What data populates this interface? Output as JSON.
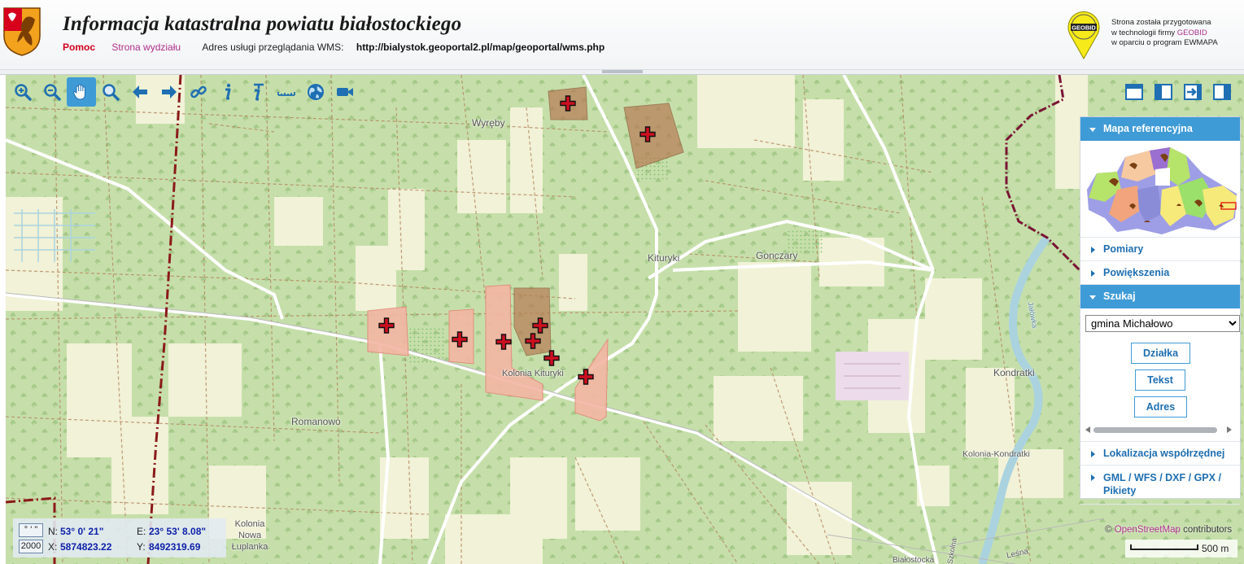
{
  "header": {
    "title": "Informacja katastralna powiatu białostockiego",
    "links": {
      "help": "Pomoc",
      "department": "Strona wydziału"
    },
    "wms_label": "Adres usługi przeglądania WMS:",
    "wms_url": "http://bialystok.geoportal2.pl/map/geoportal/wms.php",
    "vendor": {
      "logo_text": "GEOBID",
      "line1": "Strona została przygotowana",
      "line2_prefix": "w technologii firmy ",
      "line2_brand": "GEOBID",
      "line3": "w oparciu o program EWMAPA"
    }
  },
  "toolbar": {
    "tools": [
      "zoom-in-icon",
      "zoom-out-icon",
      "pan-hand-icon",
      "zoom-window-icon",
      "back-arrow-icon",
      "forward-arrow-icon",
      "link-icon",
      "info-icon",
      "info-extended-icon",
      "measure-ruler-icon",
      "globe-icon",
      "video-camera-icon"
    ],
    "active_tool": "pan-hand-icon",
    "panel_tools": [
      "layout-top-icon",
      "layout-side-icon",
      "collapse-panel-icon",
      "panel-right-icon"
    ]
  },
  "map": {
    "place_labels": [
      "Wyręby",
      "Kituryki",
      "Gonczary",
      "Kolonia Kituryki",
      "Romanowo",
      "Kondratki",
      "Kolonia-Kondratki",
      "Kolonia Nowa Łuplanka",
      "Białostocka",
      "Leśna",
      "Szkolna",
      "Jałówka"
    ],
    "attribution": {
      "prefix": "©",
      "link": "OpenStreetMap",
      "suffix": "contributors"
    },
    "scale": "500 m",
    "colors": {
      "forest": "#c6dfaa",
      "meadow": "#f1f2d7",
      "parcel": "#f2b7a4",
      "parcel_dark": "#b77e56",
      "boundary": "#8b1a1a",
      "road": "#ffffff"
    }
  },
  "sidepanel": {
    "reference_map": "Mapa referencyjna",
    "measurements": "Pomiary",
    "zooms": "Powiększenia",
    "search": "Szukaj",
    "gmina_selected": "gmina Michałowo",
    "search_buttons": {
      "parcel": "Działka",
      "text": "Tekst",
      "address": "Adres"
    },
    "coordinate_location": "Lokalizacja współrzędnej",
    "export": "GML / WFS / DXF / GPX / Pikiety"
  },
  "coordinates": {
    "format_dms": "° ' \"",
    "format_2000": "2000",
    "n_label": "N:",
    "n_value": "53° 0' 21\"",
    "e_label": "E:",
    "e_value": "23° 53' 8.08\"",
    "x_label": "X:",
    "x_value": "5874823.22",
    "y_label": "Y:",
    "y_value": "8492319.69"
  }
}
